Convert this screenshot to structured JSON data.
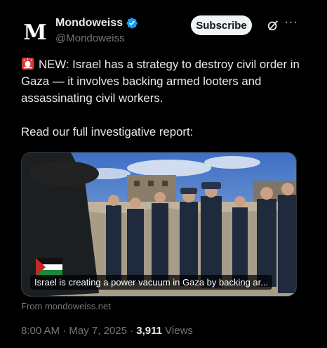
{
  "account": {
    "logo_letter": "M",
    "display_name": "Mondoweiss",
    "handle": "@Mondoweiss",
    "verified": true,
    "verified_color": "#1d9bf0"
  },
  "actions": {
    "subscribe_label": "Subscribe",
    "grok_icon": "grok-icon",
    "more_icon": "more-icon",
    "more_glyph": "···"
  },
  "tweet": {
    "emoji": "siren-icon",
    "line1": "NEW: Israel has a strategy to destroy civil order in Gaza — it involves backing armed looters and assassinating civil workers.",
    "line2": "Read our full investigative report:"
  },
  "card": {
    "caption": "Israel is creating a power vacuum in Gaza by backing ar...",
    "from": "From mondoweiss.net"
  },
  "meta": {
    "time": "8:00 AM",
    "sep1": " · ",
    "date": "May 7, 2025",
    "sep2": " · ",
    "views_count": "3,911",
    "views_label": " Views"
  }
}
